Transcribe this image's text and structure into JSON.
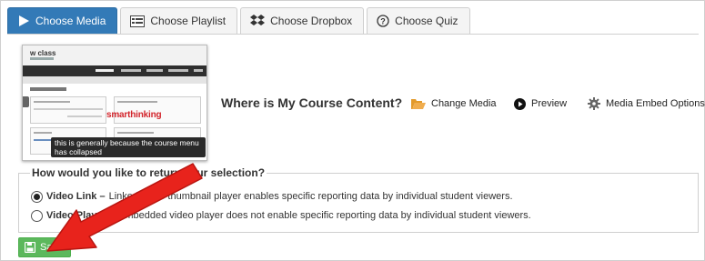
{
  "tabs": [
    {
      "label": "Choose Media",
      "icon": "play-icon",
      "active": true
    },
    {
      "label": "Choose Playlist",
      "icon": "playlist-icon",
      "active": false
    },
    {
      "label": "Choose Dropbox",
      "icon": "dropbox-icon",
      "active": false
    },
    {
      "label": "Choose Quiz",
      "icon": "question-circle-icon",
      "active": false
    }
  ],
  "preview": {
    "logo_text": "w class",
    "sponsor_text": "smarthinking",
    "tooltip": "this is generally because the course menu has collapsed"
  },
  "content": {
    "heading": "Where is My Course Content?",
    "actions": [
      {
        "label": "Change Media",
        "icon": "folder-open-icon"
      },
      {
        "label": "Preview",
        "icon": "play-circle-icon"
      },
      {
        "label": "Media Embed Options",
        "icon": "gear-icon"
      }
    ]
  },
  "return_selection": {
    "legend": "How would you like to return your selection?",
    "options": [
      {
        "title": "Video Link –",
        "description": "Linked video thumbnail player enables specific reporting data by individual student viewers.",
        "selected": true
      },
      {
        "title": "Video Player –",
        "description": "Embedded video player does not enable specific reporting data by individual student viewers.",
        "selected": false
      }
    ]
  },
  "save_button": {
    "label": "Save",
    "icon": "floppy-disk-icon"
  },
  "colors": {
    "accent": "#337ab7",
    "save": "#5cb85c",
    "arrow": "#e8231c",
    "folder": "#f0ad4e"
  }
}
